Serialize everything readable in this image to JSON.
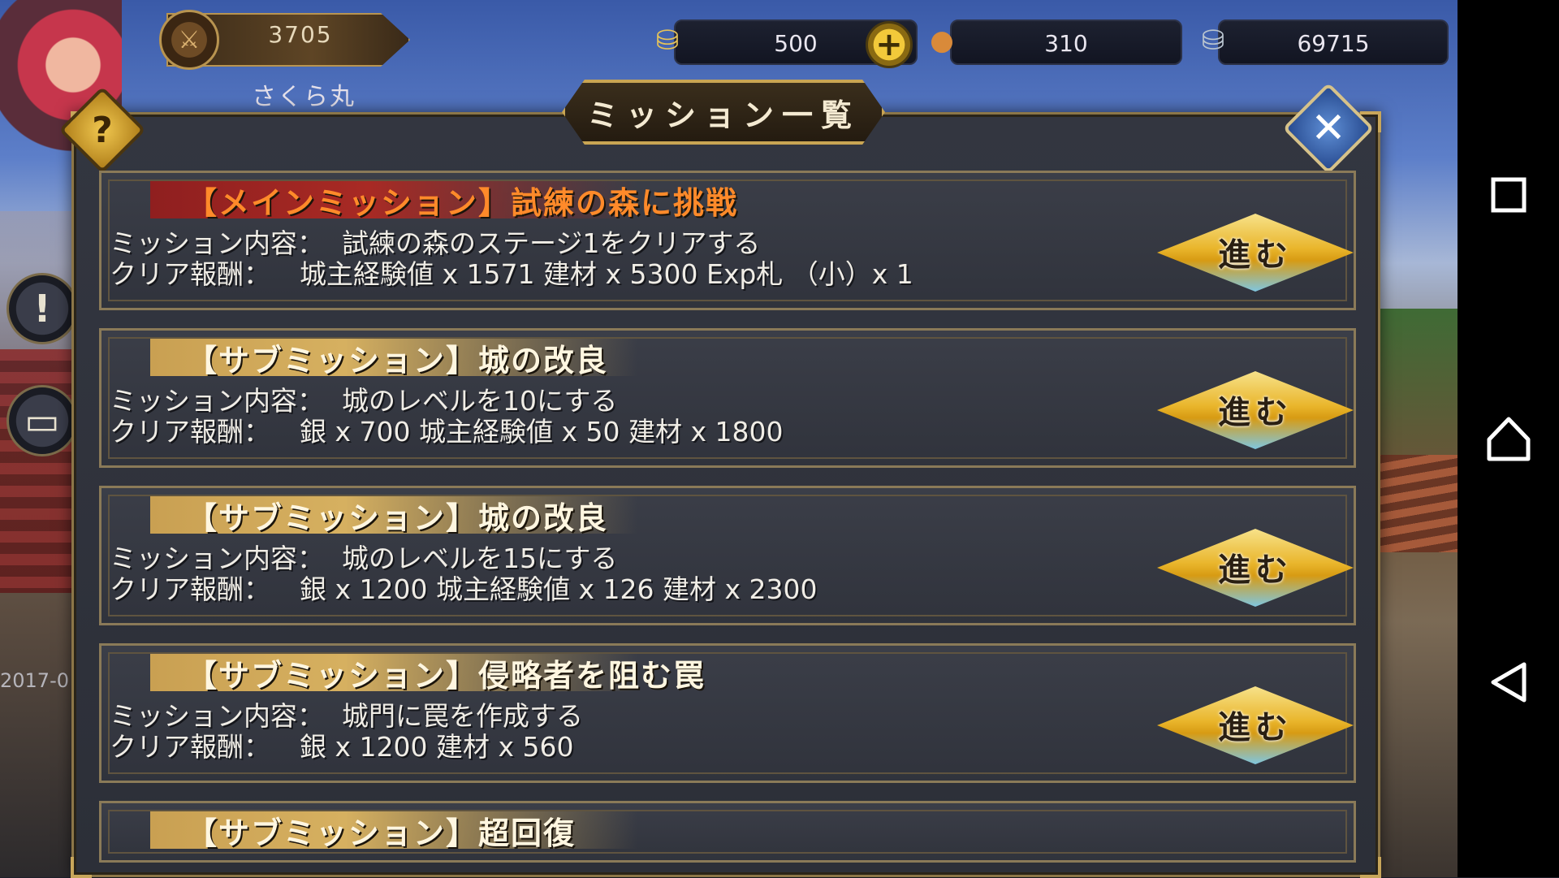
{
  "hud": {
    "level_value": "3705",
    "player_name": "さくら丸",
    "currency_gold": "500",
    "currency_food": "310",
    "currency_silver": "69715",
    "date_stamp": "2017-0"
  },
  "dialog": {
    "title": "ミッション一覧",
    "help_label": "?",
    "close_label": "✕"
  },
  "missions": [
    {
      "title": "【メインミッション】試練の森に挑戦",
      "type": "main",
      "content_label": "ミッション内容：",
      "content": "試練の森のステージ1をクリアする",
      "reward_label": "クリア報酬：",
      "reward": "城主経験値 x 1571  建材 x 5300  Exp札 （小）x 1",
      "button": "進む"
    },
    {
      "title": "【サブミッション】城の改良",
      "type": "sub",
      "content_label": "ミッション内容：",
      "content": "城のレベルを10にする",
      "reward_label": "クリア報酬：",
      "reward": "銀 x 700  城主経験値 x 50  建材 x 1800",
      "button": "進む"
    },
    {
      "title": "【サブミッション】城の改良",
      "type": "sub",
      "content_label": "ミッション内容：",
      "content": "城のレベルを15にする",
      "reward_label": "クリア報酬：",
      "reward": "銀 x 1200  城主経験値 x 126  建材 x 2300",
      "button": "進む"
    },
    {
      "title": "【サブミッション】侵略者を阻む罠",
      "type": "sub",
      "content_label": "ミッション内容：",
      "content": "城門に罠を作成する",
      "reward_label": "クリア報酬：",
      "reward": "銀 x 1200  建材 x 560",
      "button": "進む"
    },
    {
      "title": "【サブミッション】超回復",
      "type": "sub"
    }
  ],
  "colors": {
    "main_title": "#ff8a2a",
    "sub_title": "#fff6e0",
    "frame_gold": "#c9a553",
    "panel_bg": "#30333c"
  },
  "icons": {
    "help": "question-icon",
    "close": "close-icon",
    "nav_recent": "square-icon",
    "nav_home": "home-icon",
    "nav_back": "back-triangle-icon"
  }
}
